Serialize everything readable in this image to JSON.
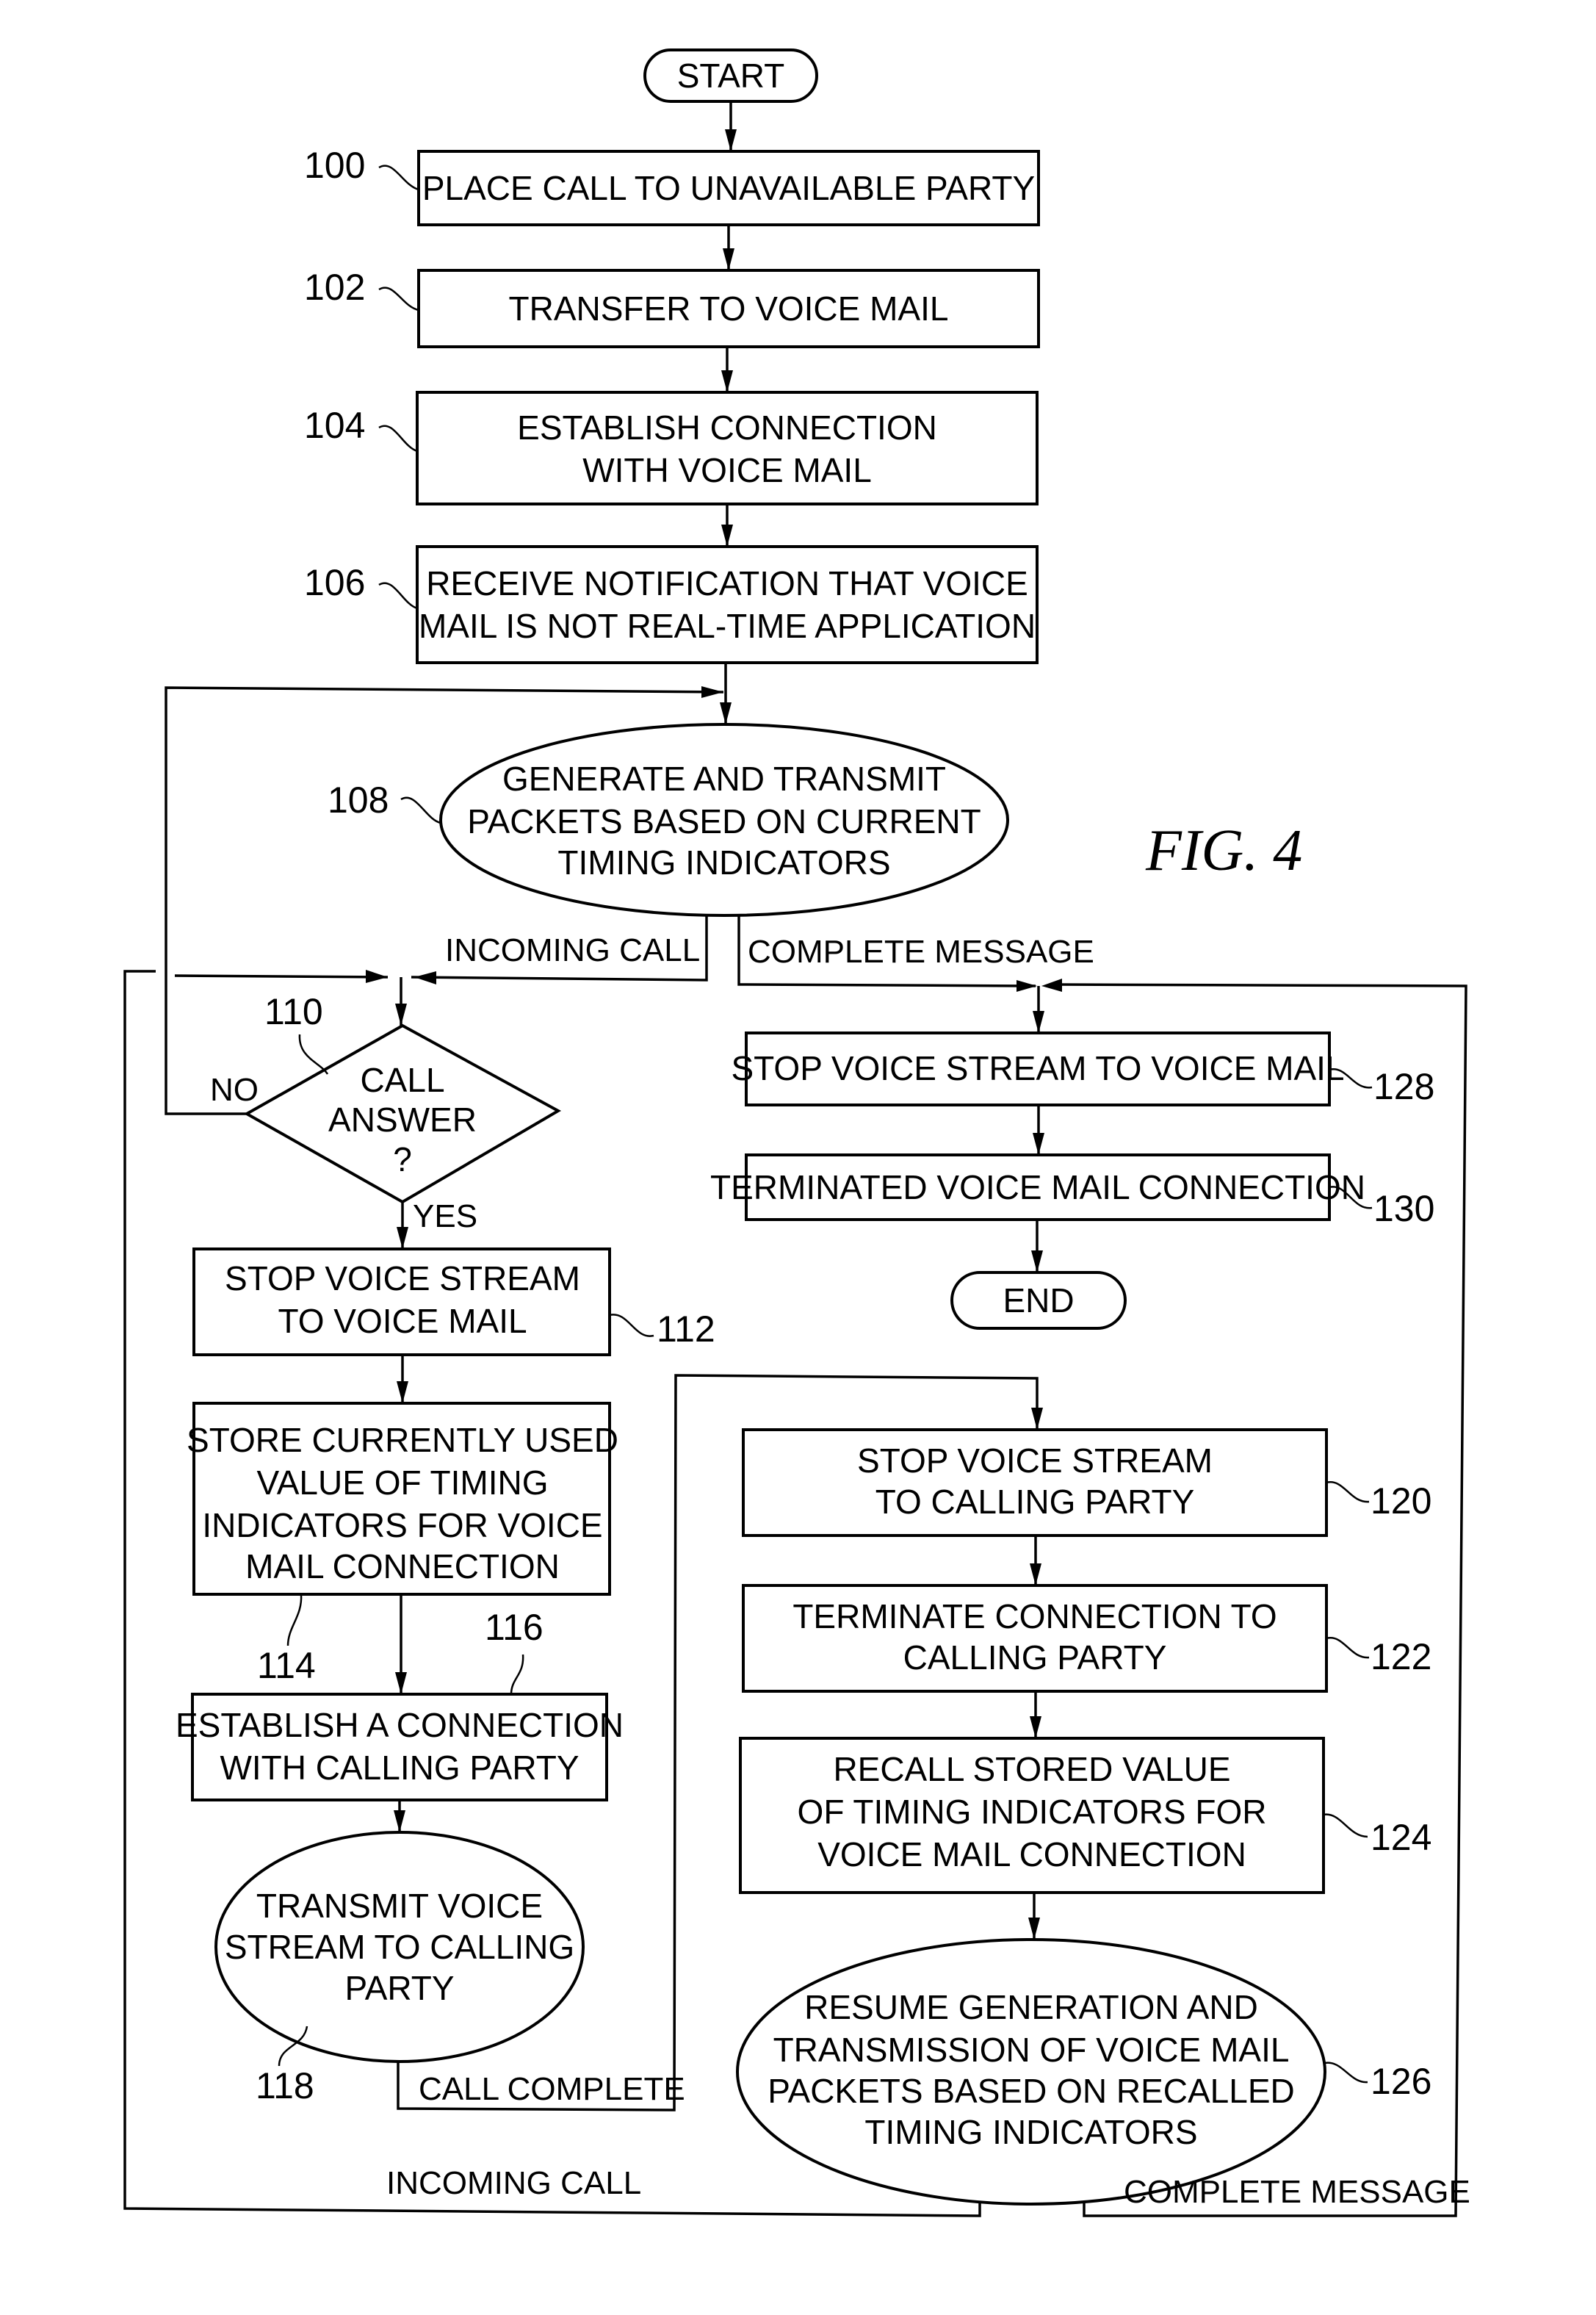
{
  "figure": {
    "title": "FIG. 4"
  },
  "terminals": {
    "start": "START",
    "end": "END"
  },
  "steps": {
    "s100": {
      "ref": "100",
      "lines": [
        "PLACE CALL TO UNAVAILABLE PARTY"
      ]
    },
    "s102": {
      "ref": "102",
      "lines": [
        "TRANSFER TO VOICE MAIL"
      ]
    },
    "s104": {
      "ref": "104",
      "lines": [
        "ESTABLISH CONNECTION",
        "WITH VOICE MAIL"
      ]
    },
    "s106": {
      "ref": "106",
      "lines": [
        "RECEIVE NOTIFICATION THAT VOICE",
        "MAIL IS NOT REAL-TIME APPLICATION"
      ]
    },
    "s108": {
      "ref": "108",
      "lines": [
        "GENERATE AND TRANSMIT",
        "PACKETS BASED ON CURRENT",
        "TIMING INDICATORS"
      ]
    },
    "s110": {
      "ref": "110",
      "lines": [
        "CALL",
        "ANSWER",
        "?"
      ]
    },
    "s112": {
      "ref": "112",
      "lines": [
        "STOP VOICE STREAM",
        "TO VOICE MAIL"
      ]
    },
    "s114": {
      "ref": "114",
      "lines": [
        "STORE CURRENTLY USED",
        "VALUE OF TIMING",
        "INDICATORS FOR VOICE",
        "MAIL CONNECTION"
      ]
    },
    "s116": {
      "ref": "116",
      "lines": [
        "ESTABLISH A CONNECTION",
        "WITH CALLING PARTY"
      ]
    },
    "s118": {
      "ref": "118",
      "lines": [
        "TRANSMIT VOICE",
        "STREAM TO CALLING",
        "PARTY"
      ]
    },
    "s120": {
      "ref": "120",
      "lines": [
        "STOP VOICE STREAM",
        "TO CALLING PARTY"
      ]
    },
    "s122": {
      "ref": "122",
      "lines": [
        "TERMINATE CONNECTION TO",
        "CALLING PARTY"
      ]
    },
    "s124": {
      "ref": "124",
      "lines": [
        "RECALL STORED VALUE",
        "OF TIMING INDICATORS FOR",
        "VOICE MAIL CONNECTION"
      ]
    },
    "s126": {
      "ref": "126",
      "lines": [
        "RESUME GENERATION AND",
        "TRANSMISSION OF VOICE MAIL",
        "PACKETS BASED ON RECALLED",
        "TIMING INDICATORS"
      ]
    },
    "s128": {
      "ref": "128",
      "lines": [
        "STOP VOICE STREAM TO VOICE MAIL"
      ]
    },
    "s130": {
      "ref": "130",
      "lines": [
        "TERMINATED VOICE MAIL CONNECTION"
      ]
    }
  },
  "edge_labels": {
    "incoming_call_top": "INCOMING CALL",
    "complete_message_top": "COMPLETE MESSAGE",
    "no": "NO",
    "yes": "YES",
    "call_complete": "CALL COMPLETE",
    "incoming_call_bottom": "INCOMING CALL",
    "complete_message_bottom": "COMPLETE MESSAGE"
  }
}
